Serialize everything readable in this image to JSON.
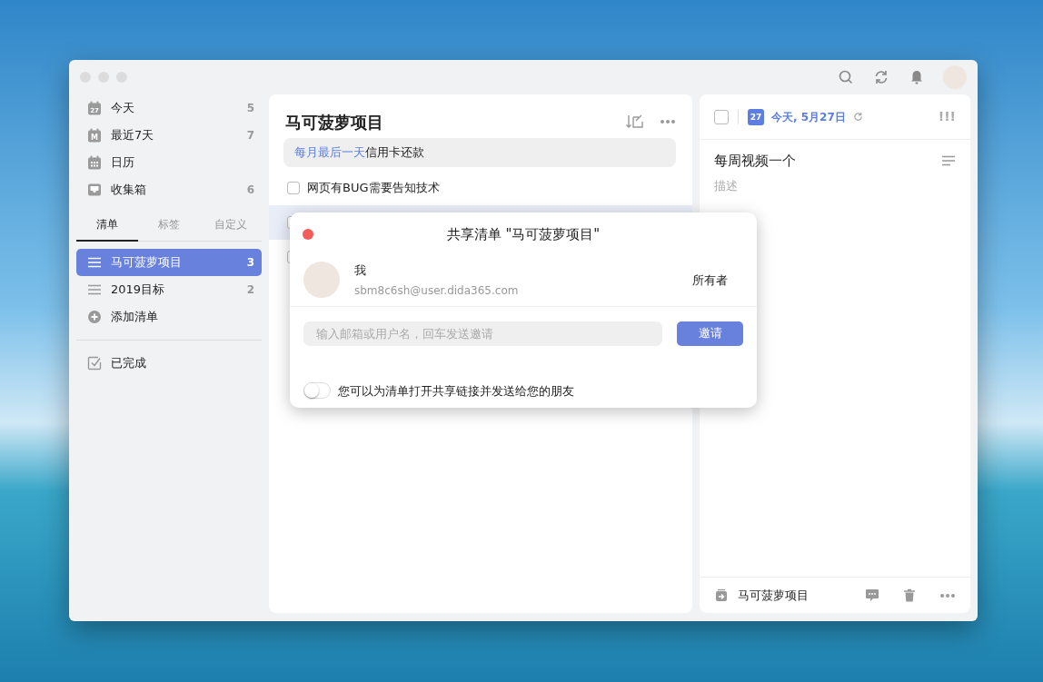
{
  "sidebar": {
    "smart_lists": [
      {
        "label": "今天",
        "count": "5",
        "kind": "calendar-day",
        "icon_text": "27"
      },
      {
        "label": "最近7天",
        "count": "7",
        "kind": "calendar-week",
        "icon_text": "M"
      },
      {
        "label": "日历",
        "kind": "calendar"
      },
      {
        "label": "收集箱",
        "count": "6",
        "kind": "inbox"
      }
    ],
    "tabs": [
      {
        "label": "清单",
        "selected": true
      },
      {
        "label": "标签",
        "selected": false
      },
      {
        "label": "自定义",
        "selected": false
      }
    ],
    "lists": [
      {
        "label": "马可菠萝项目",
        "count": "3",
        "selected": true
      },
      {
        "label": "2019目标",
        "count": "2",
        "selected": false
      }
    ],
    "add_list": "添加清单",
    "completed": "已完成"
  },
  "task_list": {
    "title": "马可菠萝项目",
    "tasks": [
      {
        "kind": "recurring",
        "date_text": "每月最后一天",
        "title": "信用卡还款",
        "selected": false
      },
      {
        "kind": "checkbox",
        "title": "网页有BUG需要告知技术",
        "checked": false,
        "selected": false
      },
      {
        "kind": "checkbox",
        "checked": false,
        "selected": true
      },
      {
        "kind": "checkbox",
        "checked": false,
        "selected": false
      }
    ]
  },
  "detail": {
    "checked": false,
    "date_icon_text": "27",
    "date": "今天, 5月27日",
    "priority": "!!!",
    "title": "每周视频一个",
    "description_placeholder": "描述",
    "list_name": "马可菠萝项目"
  },
  "share_dialog": {
    "title": "共享清单 \"马可菠萝项目\"",
    "member": {
      "name": "我",
      "email": "sbm8c6sh@user.dida365.com",
      "role": "所有者"
    },
    "invite_placeholder": "输入邮箱或用户名，回车发送邀请",
    "invite_button": "邀请",
    "share_link": {
      "label": "您可以为清单打开共享链接并发送给您的朋友",
      "on": false
    }
  }
}
